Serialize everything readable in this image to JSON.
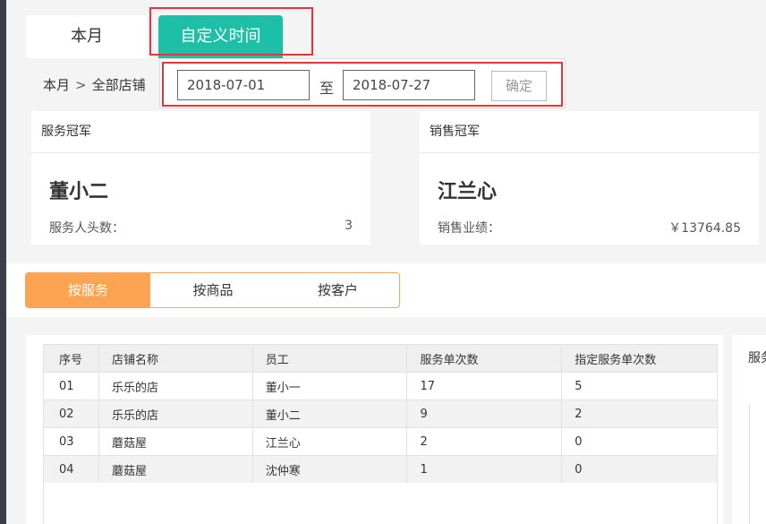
{
  "tabs": {
    "month_label": "本月",
    "custom_label": "自定义时间"
  },
  "breadcrumb": {
    "period": "本月",
    "separator": ">",
    "scope": "全部店铺"
  },
  "date_filter": {
    "start": "2018-07-01",
    "to_label": "至",
    "end": "2018-07-27",
    "confirm_label": "确定"
  },
  "service_champion": {
    "title": "服务冠军",
    "name": "董小二",
    "metric_label": "服务人头数：",
    "metric_value": "3"
  },
  "sales_champion": {
    "title": "销售冠军",
    "name": "江兰心",
    "metric_label": "销售业绩：",
    "metric_value": "￥13764.85"
  },
  "segments": {
    "by_service": "按服务",
    "by_product": "按商品",
    "by_customer": "按客户"
  },
  "table": {
    "headers": {
      "index": "序号",
      "store": "店铺名称",
      "staff": "员工",
      "service_count": "服务单次数",
      "assigned_count": "指定服务单次数"
    },
    "rows": [
      {
        "index": "01",
        "store": "乐乐的店",
        "staff": "董小一",
        "service_count": "17",
        "assigned_count": "5"
      },
      {
        "index": "02",
        "store": "乐乐的店",
        "staff": "董小二",
        "service_count": "9",
        "assigned_count": "2"
      },
      {
        "index": "03",
        "store": "蘑菇屋",
        "staff": "江兰心",
        "service_count": "2",
        "assigned_count": "0"
      },
      {
        "index": "04",
        "store": "蘑菇屋",
        "staff": "沈仲寒",
        "service_count": "1",
        "assigned_count": "0"
      }
    ]
  },
  "right_panel": {
    "label_fragment": "服务"
  },
  "colors": {
    "accent_teal": "#1dbfa6",
    "accent_orange": "#fca452",
    "highlight_red": "#e5353a"
  }
}
